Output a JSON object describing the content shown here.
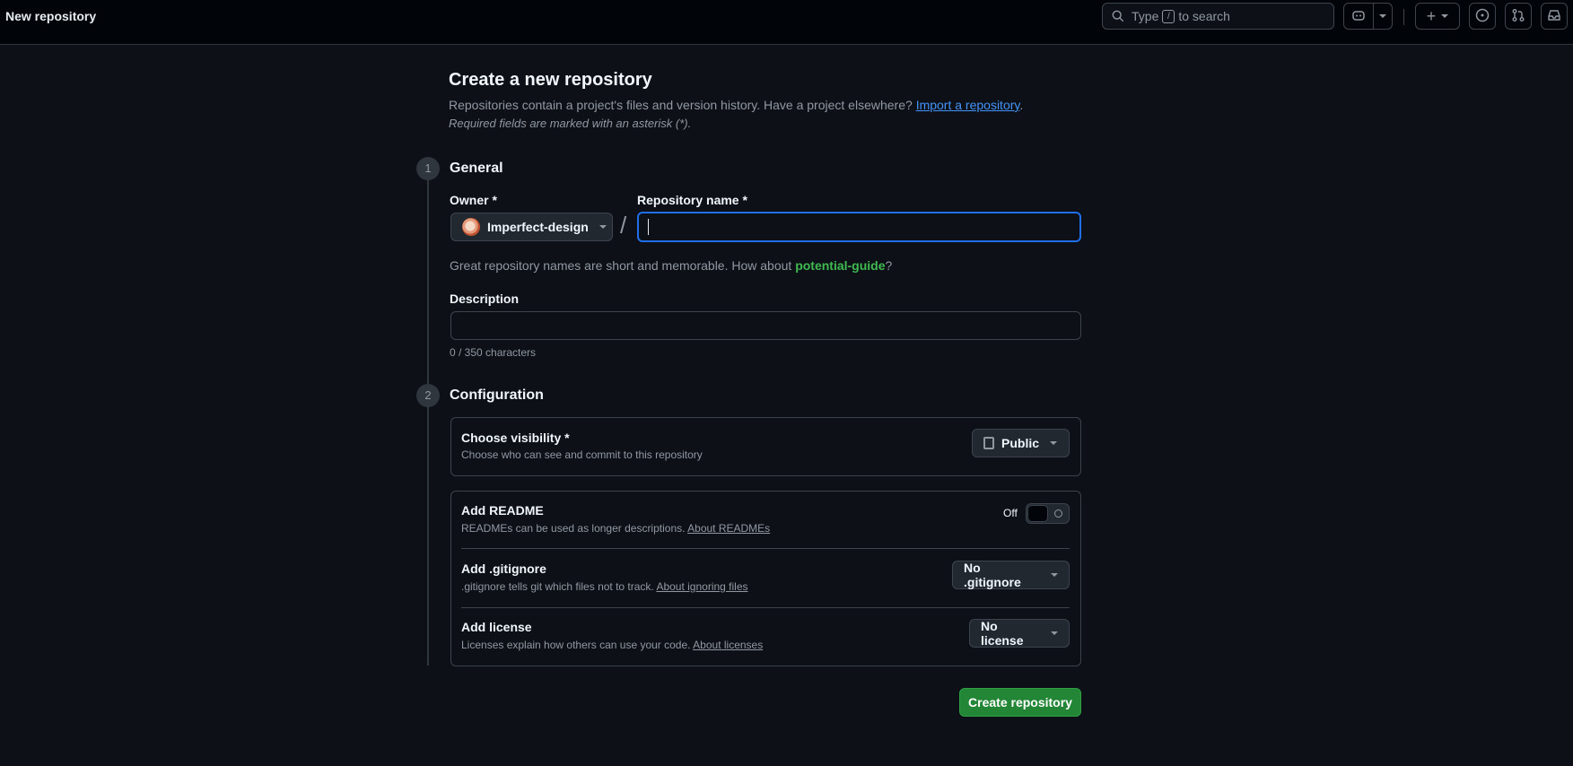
{
  "header": {
    "page_label": "New repository",
    "search": {
      "prefix": "Type",
      "key": "/",
      "suffix": "to search"
    }
  },
  "intro": {
    "title": "Create a new repository",
    "subtitle": "Repositories contain a project's files and version history. Have a project elsewhere?",
    "import_link": "Import a repository",
    "subtitle_end": ".",
    "required_note": "Required fields are marked with an asterisk (*)."
  },
  "general": {
    "step": "1",
    "title": "General",
    "owner_label": "Owner *",
    "owner_value": "Imperfect-design",
    "slash": "/",
    "repo_name_label": "Repository name *",
    "repo_name_value": "",
    "hint_prefix": "Great repository names are short and memorable. How about",
    "hint_suggestion": "potential-guide",
    "hint_suffix": "?",
    "description_label": "Description",
    "description_value": "",
    "char_count": "0 / 350 characters"
  },
  "configuration": {
    "step": "2",
    "title": "Configuration",
    "visibility": {
      "title": "Choose visibility *",
      "desc": "Choose who can see and commit to this repository",
      "value": "Public"
    },
    "readme": {
      "title": "Add README",
      "desc": "READMEs can be used as longer descriptions.",
      "link": "About READMEs",
      "toggle_label": "Off"
    },
    "gitignore": {
      "title": "Add .gitignore",
      "desc": ".gitignore tells git which files not to track.",
      "link": "About ignoring files",
      "value": "No .gitignore"
    },
    "license": {
      "title": "Add license",
      "desc": "Licenses explain how others can use your code.",
      "link": "About licenses",
      "value": "No license"
    }
  },
  "actions": {
    "create_label": "Create repository"
  }
}
